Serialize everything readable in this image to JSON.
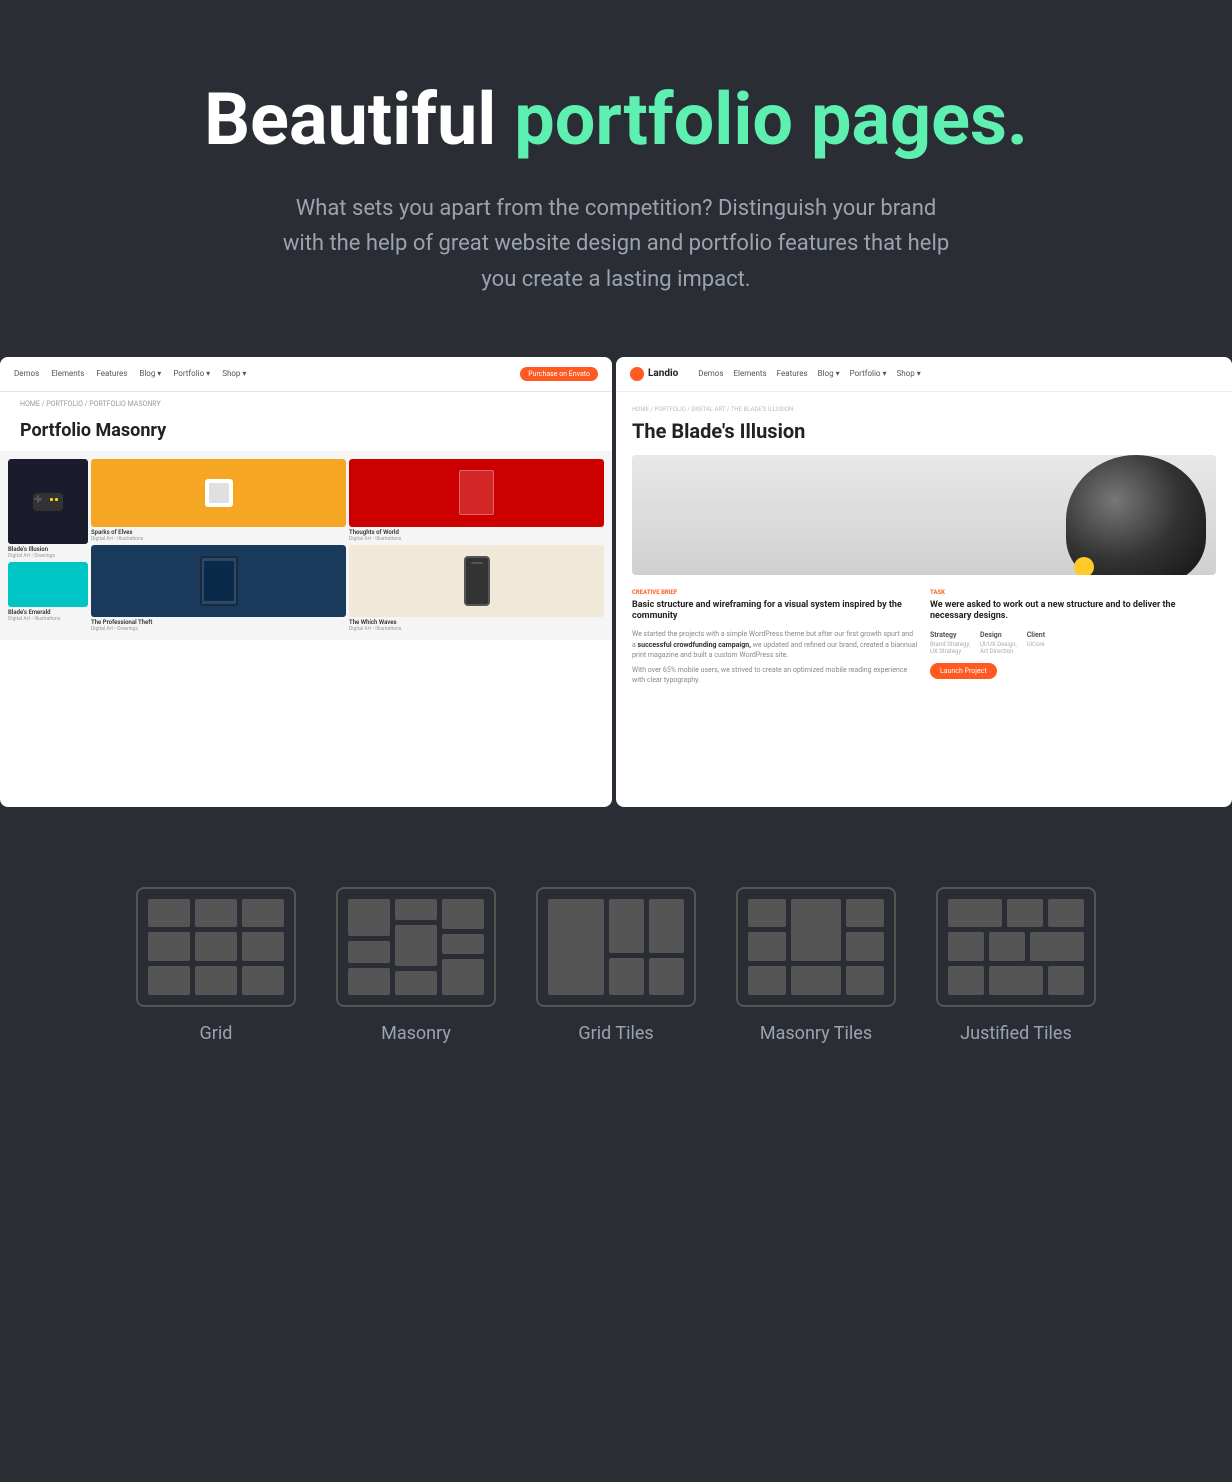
{
  "page": {
    "background": "#2a2d33"
  },
  "header": {
    "title_plain": "Beautiful ",
    "title_accent": "portfolio pages.",
    "subtitle": "What sets you apart from the competition? Distinguish your brand with the help of great website design and portfolio features that help you create a lasting impact."
  },
  "screenshot_left": {
    "nav_items": [
      "Demos",
      "Elements",
      "Features",
      "Blog",
      "Portfolio",
      "Shop"
    ],
    "nav_btn": "Purchase on Envato",
    "breadcrumb": "HOME / PORTFOLIO / PORTFOLIO MASONRY",
    "title": "Portfolio Masonry",
    "items": [
      {
        "title": "Sparks of Elves",
        "sub": "Digital Art • Illustrations"
      },
      {
        "title": "Thoughts of World",
        "sub": "Digital Art • Illustrations"
      },
      {
        "title": "The Professional Theft",
        "sub": "Digital Art • Drawings"
      },
      {
        "title": "The Which Waves",
        "sub": "Digital Art • Illustrations"
      },
      {
        "title": "Blade's Illusion",
        "sub": "Digital Art • Drawings"
      },
      {
        "title": "Blade's Emerald",
        "sub": "Digital Art • Illustrations"
      }
    ]
  },
  "screenshot_right": {
    "logo": "Landio",
    "nav_items": [
      "Demos",
      "Elements",
      "Features",
      "Blog",
      "Portfolio",
      "Shop"
    ],
    "breadcrumb": "HOME / PORTFOLIO / DIGITAL ART / THE BLADE'S ILLUSION",
    "title": "The Blade's Illusion",
    "left_tag": "CREATIVE BRIEF",
    "left_heading": "Basic structure and wireframing for a visual system inspired by the community",
    "left_text_1": "We started the projects with a simple WordPress theme but after our first growth spurt and a ",
    "left_text_bold": "successful crowdfunding campaign,",
    "left_text_2": " we updated and refined our brand, created a biannual print magazine and built a custom WordPress site.",
    "left_text_3": "With over 65% mobile users, we strived to create an optimized mobile reading experience with clear typography.",
    "right_tag": "TASK",
    "right_heading": "We were asked to work out a new structure and to deliver the necessary designs.",
    "stats": [
      {
        "label": "Strategy",
        "value": "Brand Strategy, UX Strategy"
      },
      {
        "label": "Design",
        "value": "UI/UX Design, Art Direction"
      },
      {
        "label": "Client",
        "value": "UiCore"
      }
    ],
    "launch_btn": "Launch Project"
  },
  "layout_types": [
    {
      "id": "grid",
      "label": "Grid",
      "icon_type": "grid"
    },
    {
      "id": "masonry",
      "label": "Masonry",
      "icon_type": "masonry"
    },
    {
      "id": "grid-tiles",
      "label": "Grid Tiles",
      "icon_type": "grid-tiles"
    },
    {
      "id": "masonry-tiles",
      "label": "Masonry Tiles",
      "icon_type": "masonry-tiles"
    },
    {
      "id": "justified-tiles",
      "label": "Justified Tiles",
      "icon_type": "justified-tiles"
    }
  ]
}
